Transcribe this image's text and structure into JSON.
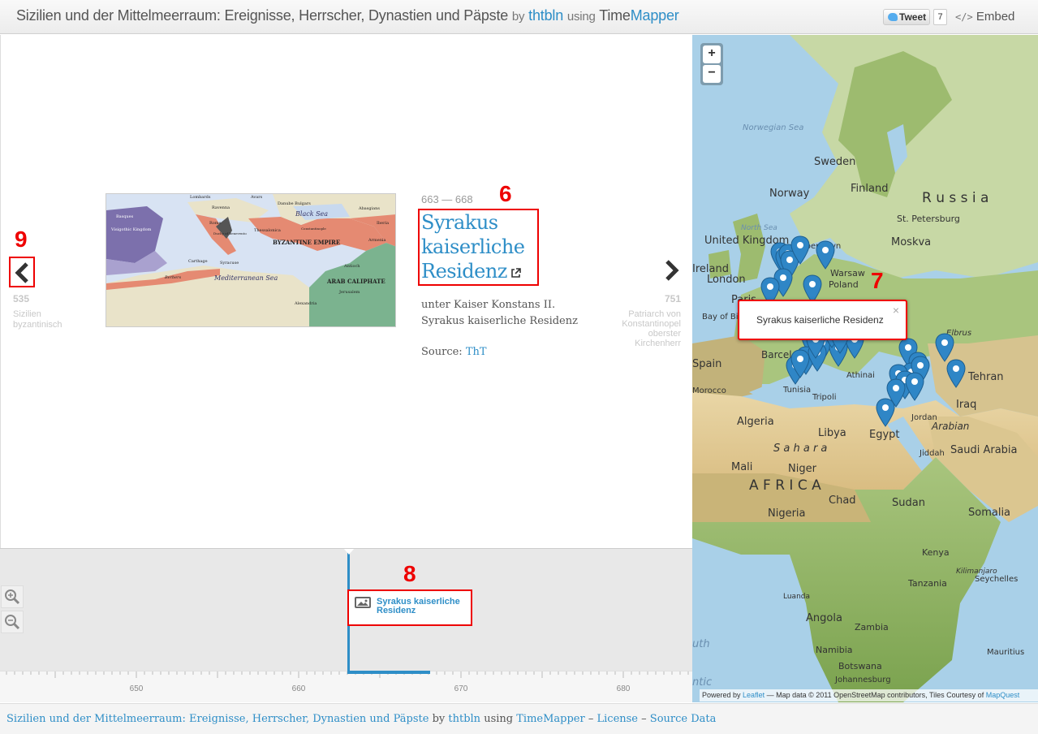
{
  "header": {
    "title": "Sizilien und der Mittelmeerraum: Ereignisse, Herrscher, Dynastien und Päpste",
    "by": "by",
    "author": "thtbln",
    "using": "using",
    "app_part1": "Time",
    "app_part2": "Mapper",
    "tweet_label": "Tweet",
    "tweet_count": "7",
    "embed_code": "</>",
    "embed_label": "Embed"
  },
  "slide": {
    "prev": {
      "date": "535",
      "title": "Sizilien byzantinisch"
    },
    "next": {
      "date": "751",
      "title": "Patriarch von Konstantinopel oberster Kirchenherr"
    },
    "date": "663 — 668",
    "headline_l1": "Syrakus",
    "headline_l2": "kaiserliche",
    "headline_l3": "Residenz",
    "description_l1": "unter Kaiser Konstans II.",
    "description_l2": "Syrakus kaiserliche Residenz",
    "source_label": "Source:",
    "source_link": "ThT",
    "media_labels": {
      "black_sea": "Black Sea",
      "mediterranean": "Mediterranean Sea",
      "byzantine": "BYZANTINE EMPIRE",
      "arab": "ARAB CALIPHATE",
      "visigothic": "Visigothic Kingdom",
      "lombards": "Lombards",
      "avars": "Avars",
      "berbers": "Berbers",
      "armenia": "Armenia",
      "alexandria": "Alexandria",
      "jerusalem": "Jerusalem",
      "antioch": "Antioch",
      "syracuse": "Syracuse",
      "carthage": "Carthage",
      "thessalonica": "Thessalonica",
      "rome": "Rome",
      "ravenna": "Ravenna",
      "basques": "Basques",
      "abasgians": "Abasgians",
      "iberia": "Iberia",
      "danube_bulgars": "Danube Bulgars",
      "duchy": "Duchy of Benevento",
      "constantinople": "Constantinople"
    }
  },
  "annotations": {
    "n6": "6",
    "n7": "7",
    "n8": "8",
    "n9": "9"
  },
  "timeline": {
    "event_label": "Syrakus kaiserliche Residenz",
    "ticks": [
      "650",
      "660",
      "670",
      "680"
    ]
  },
  "map": {
    "zoom_in": "+",
    "zoom_out": "−",
    "popup_text": "Syrakus kaiserliche Residenz",
    "popup_close": "×",
    "labels": {
      "norwegian_sea": "Norwegian Sea",
      "sweden": "Sweden",
      "finland": "Finland",
      "norway": "Norway",
      "russia": "R u s s i a",
      "st_petersburg": "St. Petersburg",
      "north_sea": "North Sea",
      "moskva": "Moskva",
      "united_kingdom": "United Kingdom",
      "kobenhavn": "København",
      "ireland": "Ireland",
      "london": "London",
      "warsaw": "Warsaw",
      "poland": "Poland",
      "paris": "Paris",
      "bay_of_biscay": "Bay of Biscay",
      "elbrus": "Elbrus",
      "spain": "Spain",
      "barcelona": "Barcelona",
      "athinai": "Athinai",
      "tehran": "Tehran",
      "morocco": "Morocco",
      "tunisia": "Tunisia",
      "tripoli": "Tripoli",
      "iraq": "Iraq",
      "algeria": "Algeria",
      "libya": "Libya",
      "egypt": "Egypt",
      "jordan": "Jordan",
      "arabian": "Arabian",
      "sahara": "S a h a r a",
      "saudi_arabia": "Saudi Arabia",
      "jiddah": "Jiddah",
      "mali": "Mali",
      "niger": "Niger",
      "africa": "A F R I C A",
      "chad": "Chad",
      "sudan": "Sudan",
      "nigeria": "Nigeria",
      "somalia": "Somalia",
      "kenya": "Kenya",
      "tanzania": "Tanzania",
      "angola": "Angola",
      "zambia": "Zambia",
      "namibia": "Namibia",
      "botswana": "Botswana",
      "johannesburg": "Johannesburg",
      "seychelles": "Seychelles",
      "mauritius": "Mauritius",
      "luanda": "Luanda",
      "kilimanjaro": "Kilimanjaro",
      "atlantic_fragment": "ntic",
      "south_fragment": "uth"
    },
    "attribution_powered": "Powered by",
    "attribution_leaflet": "Leaflet",
    "attribution_middle": "— Map data © 2011 OpenStreetMap contributors, Tiles Courtesy of",
    "attribution_mapquest": "MapQuest"
  },
  "footer": {
    "title": "Sizilien und der Mittelmeerraum: Ereignisse, Herrscher, Dynastien und Päpste",
    "by": "by",
    "author": "thtbln",
    "using": "using",
    "app": "TimeMapper",
    "dash1": "–",
    "license": "License",
    "dash2": "–",
    "source_data": "Source Data"
  },
  "colors": {
    "accent": "#2e8ec7",
    "annotation": "#ee0000",
    "marker": "#2f86c6"
  }
}
